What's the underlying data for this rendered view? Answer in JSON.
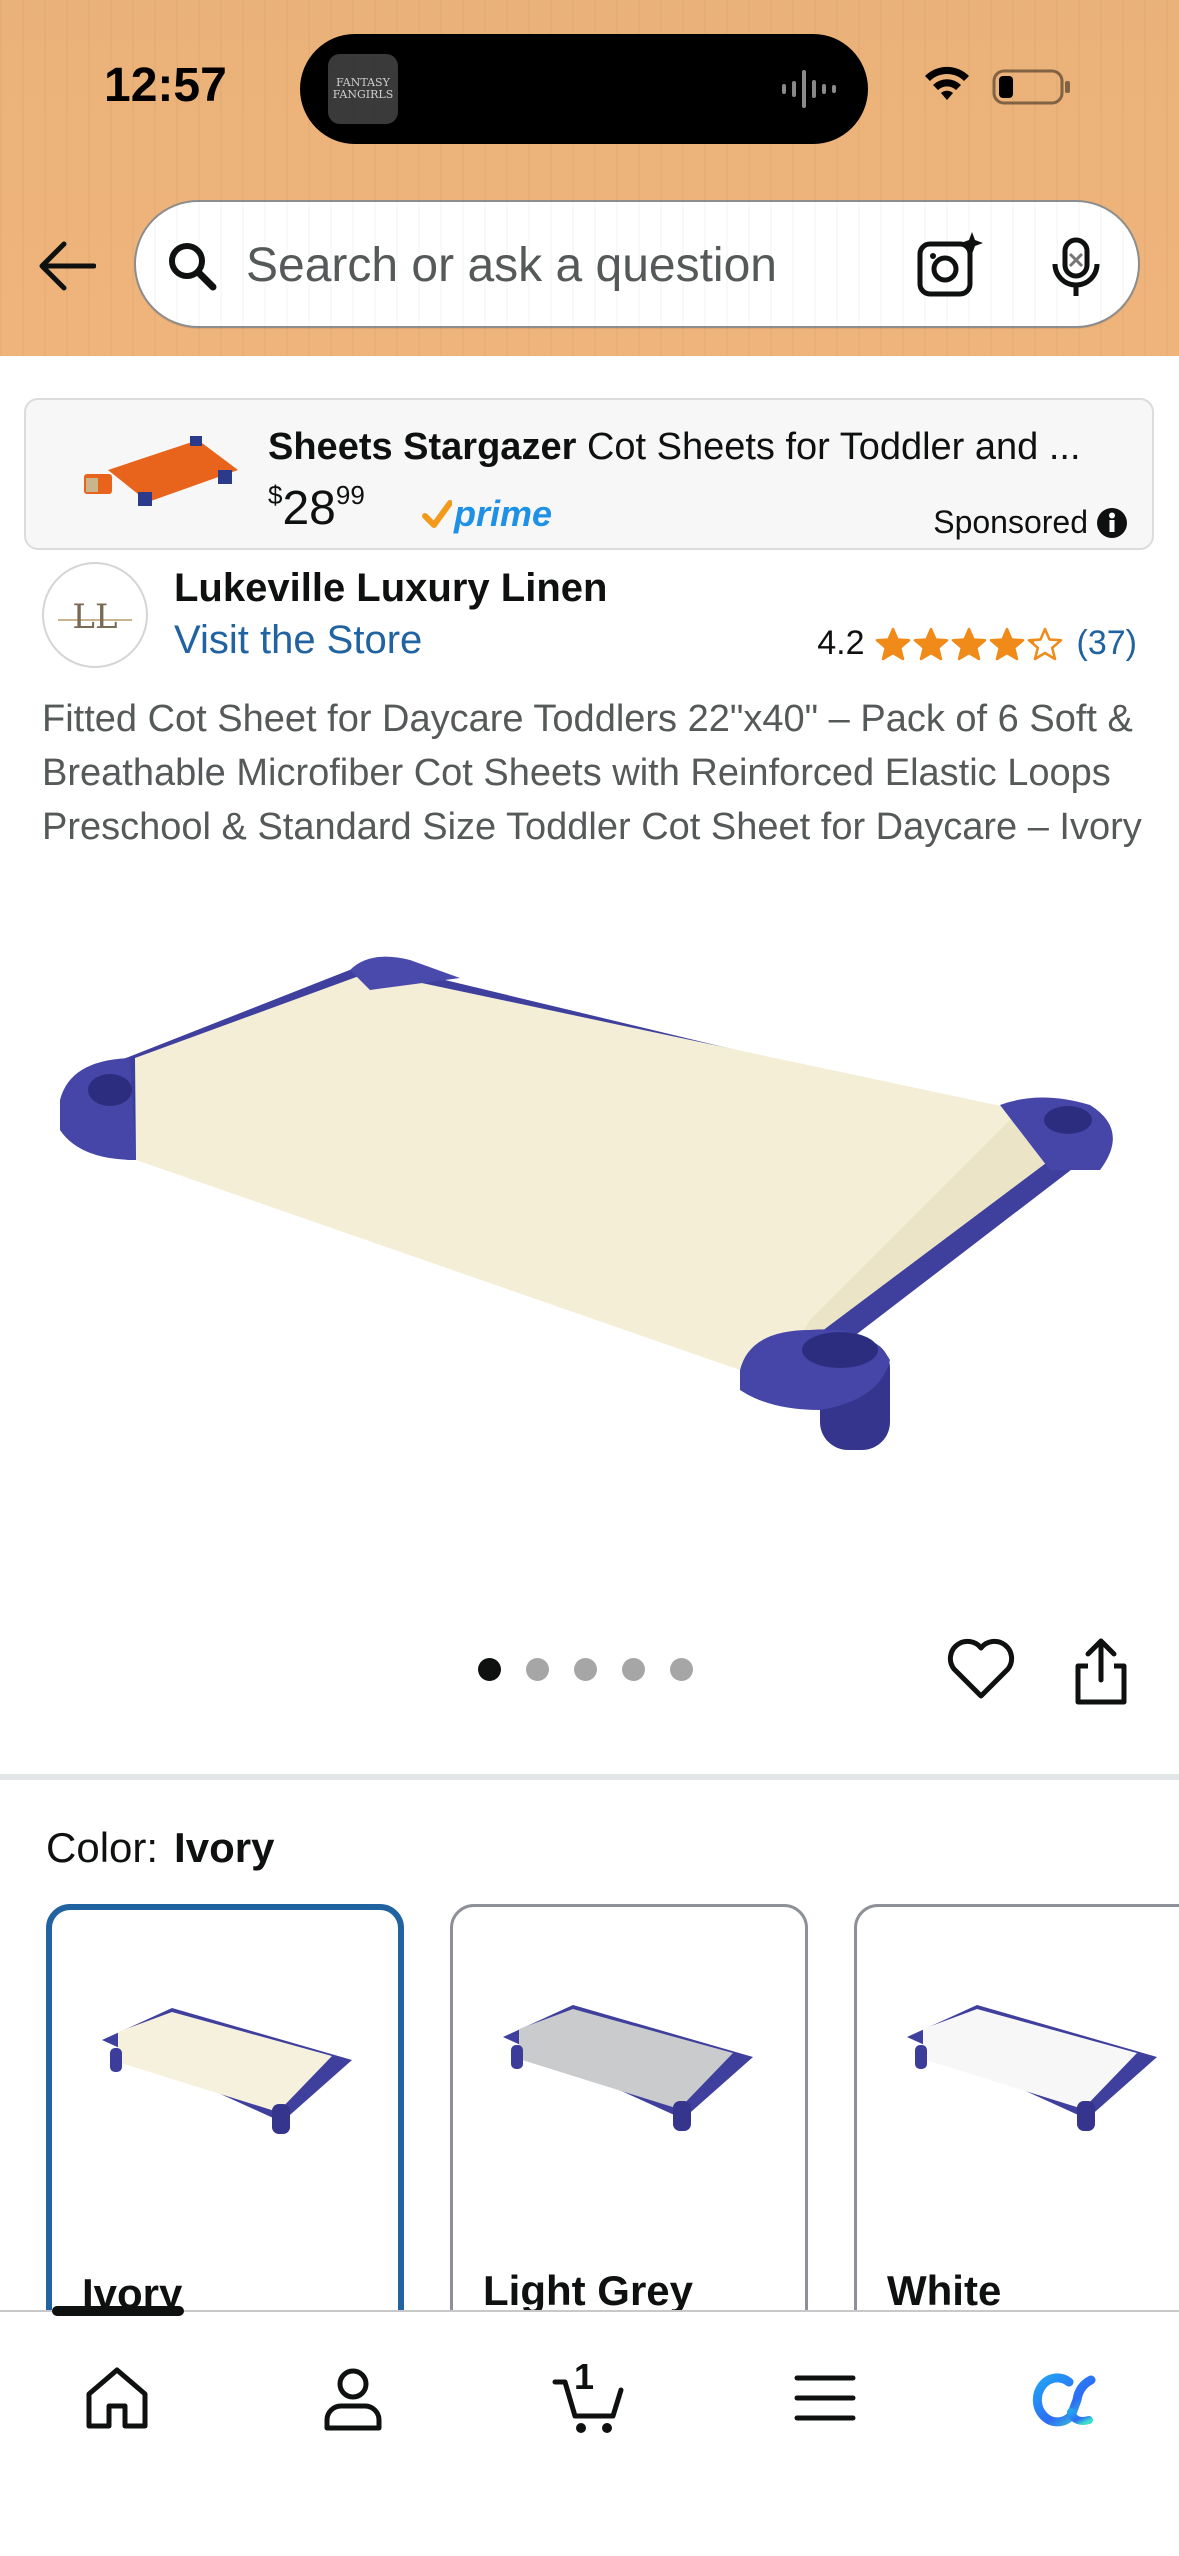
{
  "status_bar": {
    "time": "12:57",
    "island_app_label": "FANTASY FANGIRLS"
  },
  "search": {
    "placeholder": "Search or ask a question"
  },
  "sponsored_ad": {
    "brand": "Sheets Stargazer",
    "title": "Cot Sheets for Toddler and ...",
    "price_symbol": "$",
    "price_whole": "28",
    "price_fraction": "99",
    "prime_label": "prime",
    "sponsored_label": "Sponsored"
  },
  "store": {
    "name": "Lukeville Luxury Linen",
    "visit_label": "Visit the Store",
    "logo_letters": "LL",
    "rating_value": "4.2",
    "rating_fraction": 0.84,
    "review_count": "(37)"
  },
  "product": {
    "title": "Fitted Cot Sheet for Daycare Toddlers 22\"x40\" – Pack of 6 Soft & Breathable Microfiber Cot Sheets with Reinforced Elastic Loops Preschool & Standard Size Toddler Cot Sheet for Daycare – Ivory",
    "image_count": 5,
    "current_image_index": 0
  },
  "color_selector": {
    "label": "Color:",
    "selected": "Ivory",
    "options": [
      {
        "name": "Ivory",
        "sheet_color": "#f6f1dc"
      },
      {
        "name": "Light Grey",
        "sheet_color": "#c9cbcd"
      },
      {
        "name": "White",
        "sheet_color": "#f7f7f7"
      }
    ]
  },
  "tabbar": {
    "cart_count": "1",
    "items": [
      "home-icon",
      "account-icon",
      "cart-icon",
      "menu-icon",
      "rufus-icon"
    ]
  },
  "colors": {
    "header_bg": "#efb47b",
    "link_blue": "#2162a1",
    "star_orange": "#f08a19",
    "prime_blue": "#1e90e6",
    "cot_frame": "#3f3f9e"
  }
}
